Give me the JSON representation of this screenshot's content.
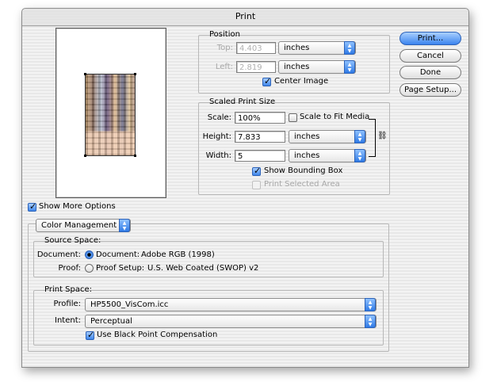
{
  "window": {
    "title": "Print"
  },
  "buttons": {
    "print": "Print...",
    "cancel": "Cancel",
    "done": "Done",
    "page_setup": "Page Setup..."
  },
  "position": {
    "title": "Position",
    "top_label": "Top:",
    "top_value": "4.403",
    "top_unit": "inches",
    "left_label": "Left:",
    "left_value": "2.819",
    "left_unit": "inches",
    "center_image": "Center Image"
  },
  "scaled": {
    "title": "Scaled Print Size",
    "scale_label": "Scale:",
    "scale_value": "100%",
    "scale_fit": "Scale to Fit Media",
    "height_label": "Height:",
    "height_value": "7.833",
    "height_unit": "inches",
    "width_label": "Width:",
    "width_value": "5",
    "width_unit": "inches",
    "show_bounding_box": "Show Bounding Box",
    "print_selected_area": "Print Selected Area"
  },
  "more_options": {
    "label": "Show More Options",
    "mode": "Color Management"
  },
  "source": {
    "title": "Source Space:",
    "document_label": "Document:",
    "document_option": "Document:",
    "document_value": "Adobe RGB (1998)",
    "proof_label": "Proof:",
    "proof_option": "Proof Setup:",
    "proof_value": "U.S. Web Coated (SWOP) v2"
  },
  "print_space": {
    "title": "Print Space:",
    "profile_label": "Profile:",
    "profile_value": "HP5500_VisCom.icc",
    "intent_label": "Intent:",
    "intent_value": "Perceptual",
    "black_point": "Use Black Point Compensation"
  },
  "icons": {
    "popup_arrows": "up-down-arrows",
    "link": "chain-link"
  },
  "colors": {
    "accent": "#3b84ee"
  }
}
